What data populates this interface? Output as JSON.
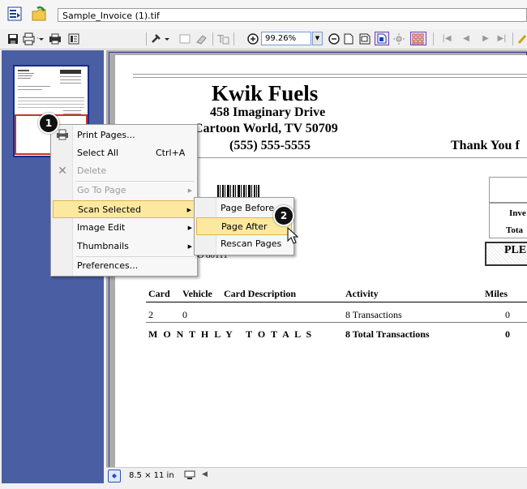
{
  "window": {
    "filename": "Sample_Invoice (1).tif"
  },
  "toolbar": {
    "zoom_value": "99.26%"
  },
  "status": {
    "page_size": "8.5 × 11 in"
  },
  "invoice": {
    "company": "Kwik Fuels",
    "address1": "458 Imaginary Drive",
    "address2": "Cartoon World, TV 50709",
    "phone": "(555) 555-5555",
    "thank_you": "Thank You f",
    "addr_fragment": "CO 80111",
    "right_labels": [
      "Inve",
      "Tota",
      "PLE"
    ],
    "table_headers": [
      "Card",
      "Vehicle",
      "Card Description",
      "Activity",
      "Miles"
    ],
    "rows": [
      [
        "2",
        "0",
        "",
        "8 Transactions",
        "0"
      ]
    ],
    "totals": {
      "label": "M O N T H L Y   T O T A L S",
      "activity": "8 Total Transactions",
      "miles": "0"
    }
  },
  "context_menu": {
    "items": [
      {
        "label": "Print Pages...",
        "accel": "",
        "submenu": false,
        "disabled": false
      },
      {
        "label": "Select All",
        "accel": "Ctrl+A",
        "submenu": false,
        "disabled": false
      },
      {
        "label": "Delete",
        "accel": "",
        "submenu": false,
        "disabled": true
      },
      {
        "label": "Go To Page",
        "accel": "",
        "submenu": true,
        "disabled": true
      },
      {
        "label": "Scan Selected",
        "accel": "",
        "submenu": true,
        "disabled": false
      },
      {
        "label": "Image Edit",
        "accel": "",
        "submenu": true,
        "disabled": false
      },
      {
        "label": "Thumbnails",
        "accel": "",
        "submenu": true,
        "disabled": false
      },
      {
        "label": "Preferences...",
        "accel": "",
        "submenu": false,
        "disabled": false
      }
    ]
  },
  "submenu": {
    "items": [
      {
        "label": "Page Before"
      },
      {
        "label": "Page After"
      },
      {
        "label": "Rescan Pages"
      }
    ]
  },
  "callouts": {
    "one": "1",
    "two": "2"
  },
  "colors": {
    "highlight": "#fde8a0",
    "thumb_pane": "#4a5fa3",
    "doc_bg": "#ababab"
  }
}
